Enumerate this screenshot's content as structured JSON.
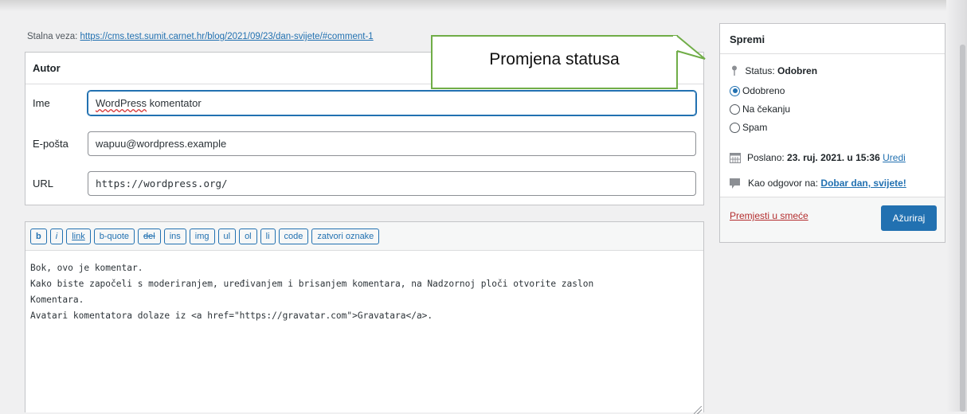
{
  "permalink": {
    "label": "Stalna veza:",
    "url": "https://cms.test.sumit.carnet.hr/blog/2021/09/23/dan-svijete/#comment-1"
  },
  "author": {
    "title": "Autor",
    "name_label": "Ime",
    "name_value_1": "WordPress",
    "name_value_2": " komentator",
    "email_label": "E-pošta",
    "email_value": "wapuu@wordpress.example",
    "url_label": "URL",
    "url_value": "https://wordpress.org/"
  },
  "toolbar": {
    "buttons": [
      "b",
      "i",
      "link",
      "b-quote",
      "del",
      "ins",
      "img",
      "ul",
      "ol",
      "li",
      "code",
      "zatvori oznake"
    ]
  },
  "editor": {
    "lines": [
      "Bok, ovo je komentar.",
      "Kako biste započeli s moderiranjem, uređivanjem i brisanjem komentara, na Nadzornoj ploči otvorite zaslon",
      "Komentara.",
      "Avatari komentatora dolaze iz <a href=\"https://gravatar.com\">Gravatara</a>."
    ]
  },
  "save": {
    "title": "Spremi",
    "status_label": "Status:",
    "status_value": "Odobren",
    "options": [
      "Odobreno",
      "Na čekanju",
      "Spam"
    ],
    "selected": "Odobreno",
    "sent_label": "Poslano:",
    "sent_value": "23. ruj. 2021. u 15:36",
    "edit_link": "Uredi",
    "reply_label": "Kao odgovor na:",
    "reply_link": "Dobar dan, svijete!",
    "trash_link": "Premjesti u smeće",
    "update_button": "Ažuriraj"
  },
  "callout": {
    "text": "Promjena statusa",
    "border_color": "#70ad47"
  },
  "colors": {
    "accent": "#2271b1",
    "danger": "#b32d2e",
    "background": "#f0f0f1"
  }
}
